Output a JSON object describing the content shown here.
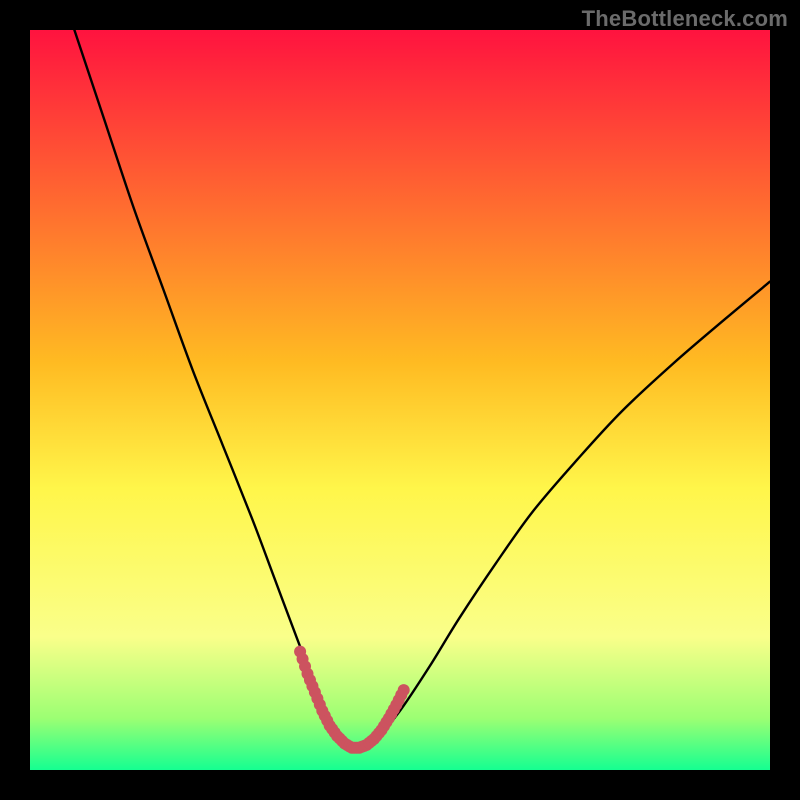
{
  "watermark": {
    "text": "TheBottleneck.com"
  },
  "chart_data": {
    "type": "line",
    "title": "",
    "xlabel": "",
    "ylabel": "",
    "xlim": [
      0,
      100
    ],
    "ylim": [
      0,
      100
    ],
    "series": [
      {
        "name": "bottleneck-curve",
        "x": [
          6,
          10,
          14,
          18,
          22,
          26,
          30,
          33,
          36,
          38.5,
          40.5,
          42,
          43.5,
          45,
          47,
          50,
          54,
          58,
          63,
          68,
          74,
          80,
          87,
          94,
          100
        ],
        "y": [
          100,
          88,
          76,
          65,
          54,
          44,
          34,
          26,
          18,
          11.5,
          7,
          4.2,
          3,
          3.2,
          4.5,
          8,
          14,
          20.5,
          28,
          35,
          42,
          48.5,
          55,
          61,
          66
        ]
      },
      {
        "name": "highlight-band",
        "x": [
          36.5,
          37.5,
          38.5,
          39.5,
          40.5,
          41.5,
          42.5,
          43.5,
          44.5,
          45.5,
          46.5,
          47.5,
          48.5,
          49.5,
          50.5
        ],
        "y": [
          16,
          13,
          10.5,
          8,
          6,
          4.6,
          3.6,
          3,
          3,
          3.4,
          4.2,
          5.4,
          7,
          8.8,
          10.8
        ]
      }
    ],
    "gradient": {
      "top": "#ff133f",
      "mid_upper": "#ffbb22",
      "mid": "#fff64a",
      "mid_lower": "#faff8a",
      "near_bottom": "#9cff73",
      "bottom": "#15ff91"
    },
    "highlight_style": {
      "type": "dotted",
      "color": "#cc535f",
      "radius": 6
    },
    "curve_style": {
      "color": "#000000",
      "width": 2.4
    }
  }
}
